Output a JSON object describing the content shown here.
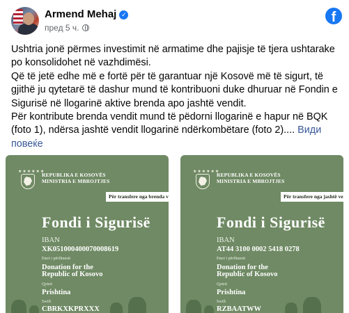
{
  "post": {
    "author": "Armend Mehaj",
    "time": "пред 5 ч.",
    "paragraphs": [
      "Ushtria jonë përmes investimit në armatime dhe pajisje të tjera ushtarake po konsolidohet në vazhdimësi.",
      "Që të jetë edhe më e fortë për të garantuar një Kosovë më të sigurt, të gjithë ju qytetarë të dashur mund të kontribuoni duke dhuruar në Fondin e Sigurisë në llogarinë aktive brenda apo jashtë vendit.",
      "Për kontribute brenda vendit mund të pëdorni llogarinë e hapur në BQK (foto 1), ndërsa jashtë vendit llogarinë ndërkombëtare (foto 2)...."
    ],
    "see_more": "Види повеќе"
  },
  "cards": [
    {
      "ministry_line1": "REPUBLIKA E KOSOVËS",
      "ministry_line2": "MINISTRIA E MBROJTJES",
      "tag": "Për transfere nga brenda vendit",
      "title": "Fondi i Sigurisë",
      "iban_label": "IBAN",
      "iban": "XK051000400070008619",
      "beneficiary_label": "Emri i përfituesit",
      "beneficiary_line1": "Donation for the",
      "beneficiary_line2": "Republic of Kosovo",
      "city_label": "Qyteti",
      "city": "Prishtina",
      "swift_label": "Swift",
      "swift": "CBRKXKPRXXX"
    },
    {
      "ministry_line1": "REPUBLIKA E KOSOVËS",
      "ministry_line2": "MINISTRIA E MBROJTJES",
      "tag": "Për transfere nga jashtë vendit",
      "title": "Fondi i Sigurisë",
      "iban_label": "IBAN",
      "iban": "AT44 3100 0002 5418 0278",
      "beneficiary_label": "Emri i përfituesit",
      "beneficiary_line1": "Donation for the",
      "beneficiary_line2": "Republic of Kosovo",
      "city_label": "Qyteti",
      "city": "Prishtina",
      "swift_label": "Swift",
      "swift": "RZBAATWW"
    }
  ],
  "icons": {
    "facebook": "facebook-logo-icon",
    "verified": "verified-badge-icon",
    "audience": "globe-icon"
  },
  "colors": {
    "facebook_blue": "#1877f2",
    "card_green": "#6f8a64",
    "link": "#385898"
  }
}
